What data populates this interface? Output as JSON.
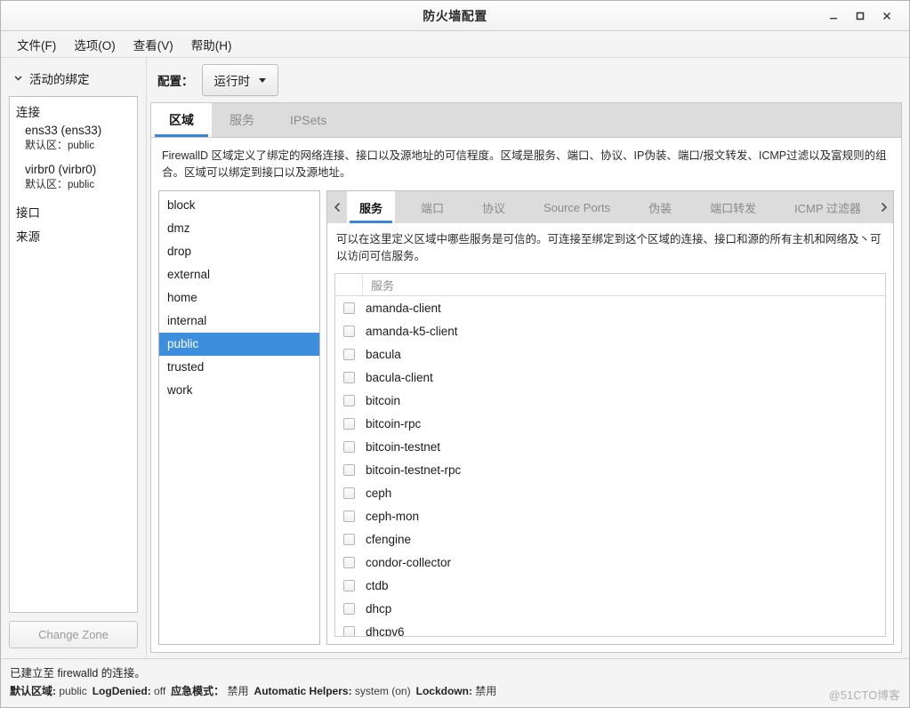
{
  "window": {
    "title": "防火墙配置",
    "controls": {
      "minimize": "—",
      "maximize": "□",
      "close": "✕"
    }
  },
  "menu": {
    "items": [
      {
        "label": "文件(F)"
      },
      {
        "label": "选项(O)"
      },
      {
        "label": "查看(V)"
      },
      {
        "label": "帮助(H)"
      }
    ]
  },
  "sidebar": {
    "header": "活动的绑定",
    "connections_label": "连接",
    "connections": [
      {
        "name": "ens33 (ens33)",
        "zone_label": "默认区：",
        "zone_value": "public"
      },
      {
        "name": "virbr0 (virbr0)",
        "zone_label": "默认区：",
        "zone_value": "public"
      }
    ],
    "interfaces_label": "接口",
    "sources_label": "来源",
    "change_zone_button": "Change Zone"
  },
  "config": {
    "label": "配置：",
    "selected": "运行时"
  },
  "top_tabs": [
    {
      "label": "区域",
      "active": true
    },
    {
      "label": "服务",
      "active": false
    },
    {
      "label": "IPSets",
      "active": false
    }
  ],
  "zone_description": "FirewallD 区域定义了绑定的网络连接、接口以及源地址的可信程度。区域是服务、端口、协议、IP伪装、端口/报文转发、ICMP过滤以及富规则的组合。区域可以绑定到接口以及源地址。",
  "zones": [
    {
      "name": "block",
      "selected": false
    },
    {
      "name": "dmz",
      "selected": false
    },
    {
      "name": "drop",
      "selected": false
    },
    {
      "name": "external",
      "selected": false
    },
    {
      "name": "home",
      "selected": false
    },
    {
      "name": "internal",
      "selected": false
    },
    {
      "name": "public",
      "selected": true
    },
    {
      "name": "trusted",
      "selected": false
    },
    {
      "name": "work",
      "selected": false
    }
  ],
  "sub_tabs": [
    {
      "label": "服务",
      "active": true
    },
    {
      "label": "端口",
      "active": false
    },
    {
      "label": "协议",
      "active": false
    },
    {
      "label": "Source Ports",
      "active": false
    },
    {
      "label": "伪装",
      "active": false
    },
    {
      "label": "端口转发",
      "active": false
    },
    {
      "label": "ICMP 过滤器",
      "active": false
    }
  ],
  "services_description": "可以在这里定义区域中哪些服务是可信的。可连接至绑定到这个区域的连接、接口和源的所有主机和网络及丶可以访问可信服务。",
  "services_table": {
    "header": "服务",
    "rows": [
      {
        "name": "amanda-client",
        "checked": false
      },
      {
        "name": "amanda-k5-client",
        "checked": false
      },
      {
        "name": "bacula",
        "checked": false
      },
      {
        "name": "bacula-client",
        "checked": false
      },
      {
        "name": "bitcoin",
        "checked": false
      },
      {
        "name": "bitcoin-rpc",
        "checked": false
      },
      {
        "name": "bitcoin-testnet",
        "checked": false
      },
      {
        "name": "bitcoin-testnet-rpc",
        "checked": false
      },
      {
        "name": "ceph",
        "checked": false
      },
      {
        "name": "ceph-mon",
        "checked": false
      },
      {
        "name": "cfengine",
        "checked": false
      },
      {
        "name": "condor-collector",
        "checked": false
      },
      {
        "name": "ctdb",
        "checked": false
      },
      {
        "name": "dhcp",
        "checked": false
      },
      {
        "name": "dhcpv6",
        "checked": false
      }
    ]
  },
  "status": {
    "connection_text": "已建立至 firewalld 的连接。",
    "fields": [
      {
        "label": "默认区域:",
        "value": "public"
      },
      {
        "label": "LogDenied:",
        "value": "off"
      },
      {
        "label": "应急模式：",
        "value": "禁用"
      },
      {
        "label": "Automatic Helpers:",
        "value": "system (on)"
      },
      {
        "label": "Lockdown:",
        "value": "禁用"
      }
    ]
  },
  "watermark": "@51CTO博客",
  "colors": {
    "accent": "#3b87d6",
    "selection": "#3e8ede",
    "tabbar": "#dcdcdc"
  }
}
